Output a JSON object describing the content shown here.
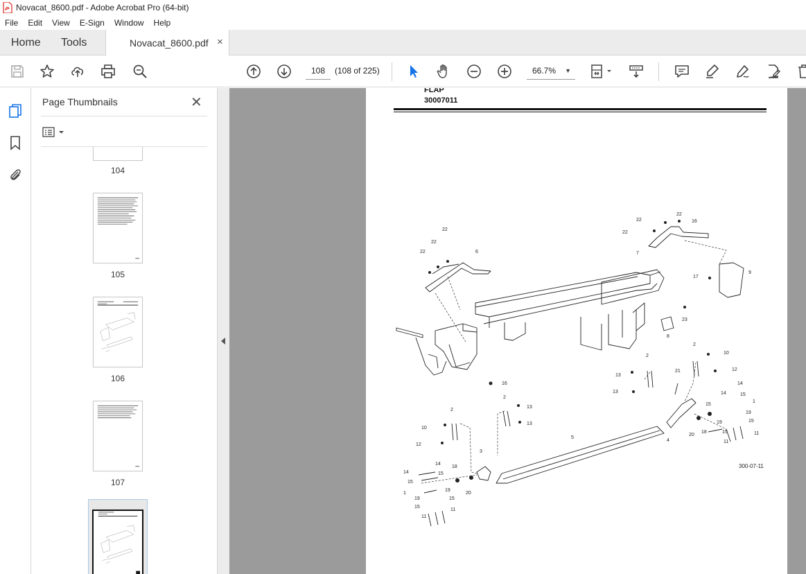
{
  "window": {
    "title": "Novacat_8600.pdf - Adobe Acrobat Pro (64-bit)"
  },
  "menu": [
    "File",
    "Edit",
    "View",
    "E-Sign",
    "Window",
    "Help"
  ],
  "tabs": {
    "home": "Home",
    "tools": "Tools",
    "document": "Novacat_8600.pdf",
    "close": "×"
  },
  "toolbar": {
    "page_current": "108",
    "page_count": "(108 of 225)",
    "zoom": "66.7%",
    "icons": [
      "save-icon",
      "star-icon",
      "upload-icon",
      "print-icon",
      "zoom-search-icon",
      "page-up-icon",
      "page-down-icon",
      "select-arrow-icon",
      "hand-icon",
      "zoom-out-icon",
      "zoom-in-icon",
      "fit-page-icon",
      "scroll-mode-icon",
      "comment-icon",
      "highlight-icon",
      "sign-icon",
      "edit-pdf-icon",
      "delete-icon"
    ]
  },
  "sidebar": {
    "title": "Page Thumbnails",
    "close": "✕",
    "thumbnails": [
      {
        "label": "104"
      },
      {
        "label": "105"
      },
      {
        "label": "106"
      },
      {
        "label": "107"
      },
      {
        "label": ""
      }
    ]
  },
  "page": {
    "heading": "FLAP",
    "code": "30007011",
    "figure_code": "300-07-11",
    "callouts": [
      "22",
      "22",
      "22",
      "6",
      "22",
      "22",
      "22",
      "16",
      "7",
      "9",
      "17",
      "23",
      "8",
      "16",
      "2",
      "10",
      "12",
      "13",
      "13",
      "2",
      "21",
      "14",
      "15",
      "1",
      "19",
      "15",
      "15",
      "11",
      "11",
      "18",
      "20",
      "4",
      "5",
      "2",
      "13",
      "13",
      "10",
      "12",
      "2",
      "3",
      "14",
      "15",
      "15",
      "1",
      "19",
      "19",
      "15",
      "11",
      "11",
      "18",
      "20"
    ]
  },
  "colors": {
    "viewer_bg": "#9b9b9b",
    "accent": "#1473e6",
    "pdf_red": "#d9251d"
  }
}
